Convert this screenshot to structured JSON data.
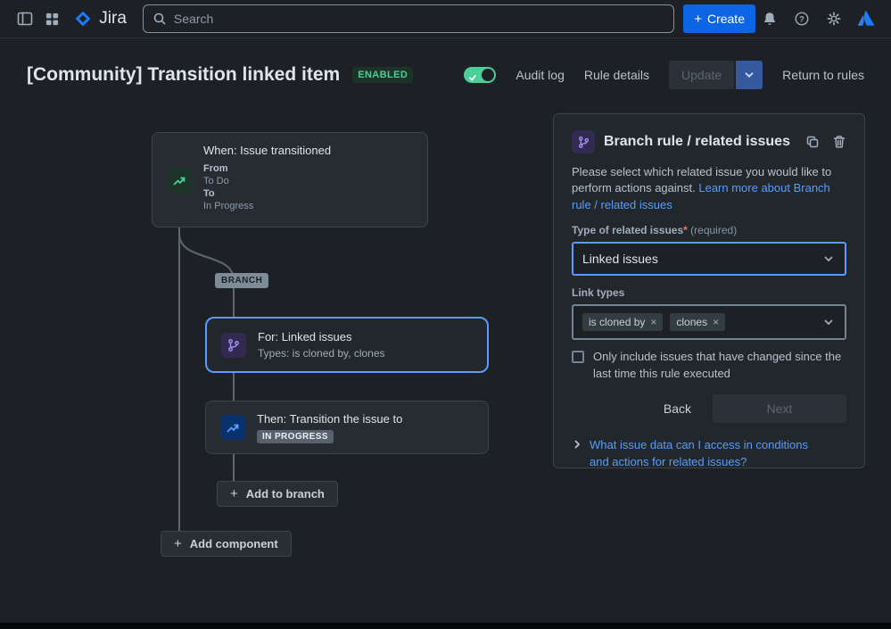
{
  "colors": {
    "accent_blue": "#579dff",
    "brand_blue": "#0c66e4",
    "success_green": "#4bce97",
    "purple_icon": "#9f8fef"
  },
  "navbar": {
    "product_name": "Jira",
    "search_placeholder": "Search",
    "create_label": "Create"
  },
  "header": {
    "title": "[Community] Transition linked item",
    "status_badge": "ENABLED",
    "audit_log_label": "Audit log",
    "rule_details_label": "Rule details",
    "update_label": "Update",
    "return_label": "Return to rules"
  },
  "canvas": {
    "when": {
      "title": "When: Issue transitioned",
      "from_label": "From",
      "from_value": "To Do",
      "to_label": "To",
      "to_value": "In Progress"
    },
    "branch_pill": "BRANCH",
    "for": {
      "title": "For: Linked issues",
      "subtitle": "Types: is cloned by, clones"
    },
    "then": {
      "title": "Then: Transition the issue to",
      "status": "IN PROGRESS"
    },
    "add_to_branch_label": "Add to branch",
    "add_component_label": "Add component"
  },
  "panel": {
    "title": "Branch rule / related issues",
    "description": "Please select which related issue you would like to perform actions against.",
    "learn_more": "Learn more about Branch rule / related issues",
    "type_label": "Type of related issues",
    "required_star": "*",
    "required_hint": "(required)",
    "type_value": "Linked issues",
    "link_types_label": "Link types",
    "tags": [
      "is cloned by",
      "clones"
    ],
    "checkbox_label": "Only include issues that have changed since the last time this rule executed",
    "back_label": "Back",
    "next_label": "Next",
    "question": "What issue data can I access in conditions and actions for related issues?"
  },
  "icons": [
    "sidebar-toggle-icon",
    "app-switcher-icon",
    "jira-logo-icon",
    "search-icon",
    "bell-icon",
    "help-icon",
    "gear-icon",
    "atlassian-logo-icon",
    "toggle-check-icon",
    "chevron-down-icon",
    "transition-icon",
    "branch-icon",
    "copy-icon",
    "trash-icon",
    "plus-icon",
    "remove-icon",
    "disclosure-chevron-icon"
  ]
}
